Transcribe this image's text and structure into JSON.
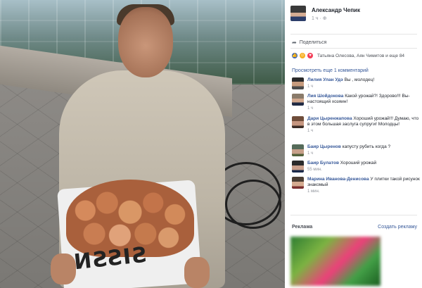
{
  "photo": {
    "sack_text": "SISSN"
  },
  "post": {
    "author_name": "Александр Чепик",
    "time": "1 ч ·",
    "share_label": "Поделиться"
  },
  "reactions": {
    "names": "Татьяна Олесова, Аян Чимитов и еще 84"
  },
  "comments": {
    "more_label": "Просмотреть еще 1 комментарий",
    "items": [
      {
        "name": "Лилия Улан Удэ",
        "text": "Вы , молодец!",
        "meta": "1 ч"
      },
      {
        "name": "Лия Шойдокова",
        "text": "Какой урожай?! Здорово!!! Вы- настоящий хозяин!",
        "meta": "1 ч"
      },
      {
        "name": "Дари Цыренжапова",
        "text": "Хороший урожай!!! Думаю, что в этом большая заслуга супруги! Молодцы!",
        "meta": "1 ч"
      },
      {
        "name": "Баир Цыренов",
        "text": "капусту рубить когда ?",
        "meta": "1 ч"
      },
      {
        "name": "Баир Булатов",
        "text": "Хороший урожай",
        "meta": "55 мин."
      },
      {
        "name": "Марина Иванова-Денисова",
        "text": "У плитки такой рисунок знакомый",
        "meta": "1 мин."
      }
    ]
  },
  "ads": {
    "title": "Реклама",
    "create_label": "Создать рекламу"
  }
}
